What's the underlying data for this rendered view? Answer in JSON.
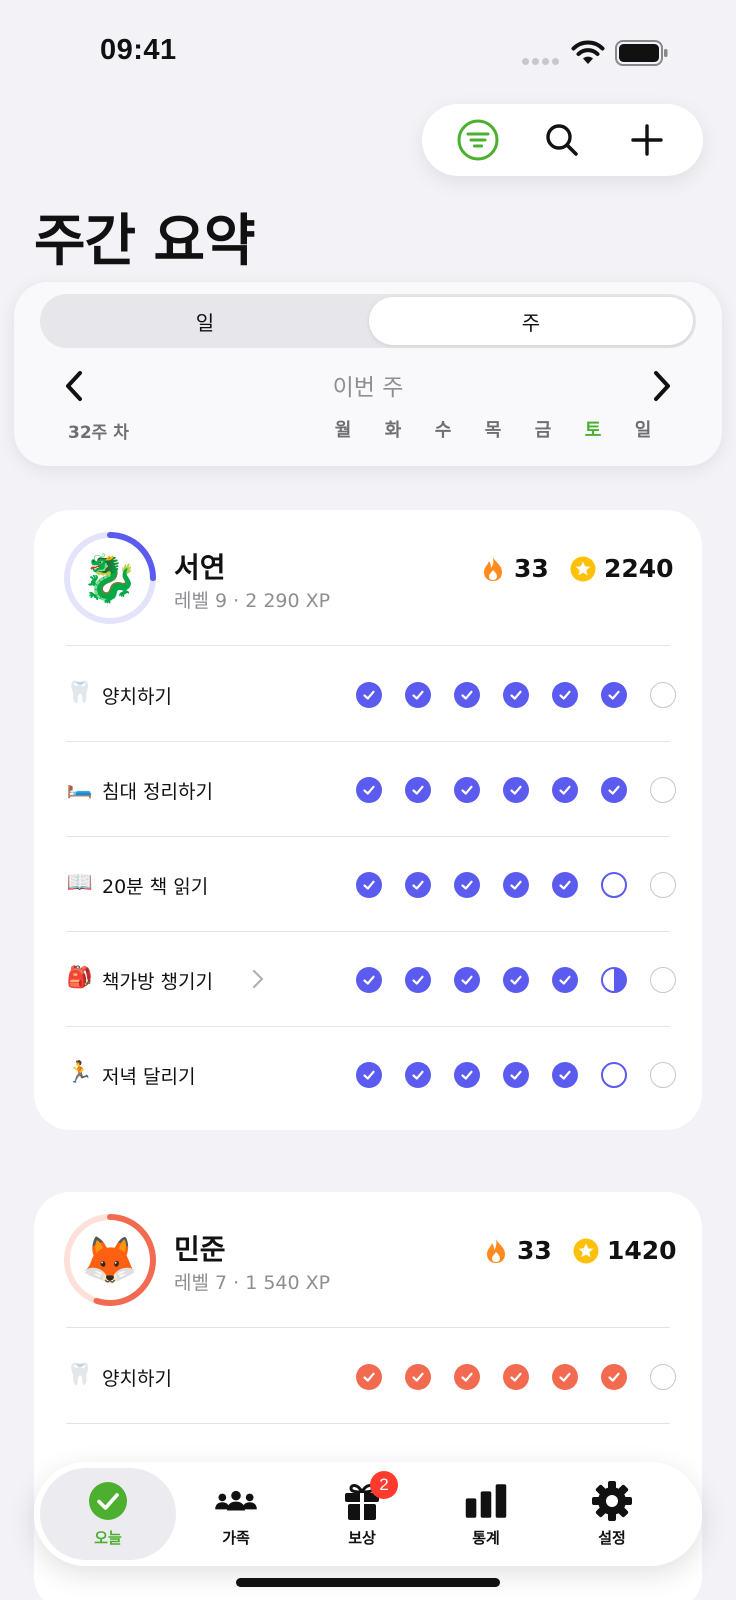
{
  "status_bar": {
    "time": "09:41"
  },
  "colors": {
    "accent_green": "#4caf2f",
    "member1": "#5b5bf0",
    "member2": "#f26b50",
    "flame": "#ff8a1e",
    "star": "#ffc107",
    "badge": "#ff3b30"
  },
  "top_actions": {
    "icons": [
      "filter-icon",
      "search-icon",
      "plus-icon"
    ]
  },
  "page": {
    "title": "주간 요약"
  },
  "week_panel": {
    "segments": [
      "일",
      "주"
    ],
    "selected_segment": "주",
    "week_label": "이번 주",
    "week_number": "32주 차",
    "weekdays": [
      "월",
      "화",
      "수",
      "목",
      "금",
      "토",
      "일"
    ],
    "today": "토"
  },
  "members": [
    {
      "name": "서연",
      "level": "레벨 9 · 2 290 XP",
      "avatar": "🐉",
      "level_progress": 0.25,
      "streak": "33",
      "stars": "2240",
      "tasks": [
        {
          "emoji": "🦷",
          "label": "양치하기",
          "status": [
            "done",
            "done",
            "done",
            "done",
            "done",
            "done",
            "empty"
          ]
        },
        {
          "emoji": "🛏️",
          "label": "침대 정리하기",
          "status": [
            "done",
            "done",
            "done",
            "done",
            "done",
            "done",
            "empty"
          ]
        },
        {
          "emoji": "📖",
          "label": "20분 책 읽기",
          "status": [
            "done",
            "done",
            "done",
            "done",
            "done",
            "ring",
            "empty"
          ]
        },
        {
          "emoji": "🎒",
          "label": "책가방 챙기기",
          "status": [
            "done",
            "done",
            "done",
            "done",
            "done",
            "half",
            "empty"
          ]
        },
        {
          "emoji": "🏃",
          "label": "저녁 달리기",
          "status": [
            "done",
            "done",
            "done",
            "done",
            "done",
            "ring",
            "empty"
          ]
        }
      ]
    },
    {
      "name": "민준",
      "level": "레벨 7 · 1 540 XP",
      "avatar": "🦊",
      "level_progress": 0.55,
      "streak": "33",
      "stars": "1420",
      "tasks": [
        {
          "emoji": "🦷",
          "label": "양치하기",
          "status": [
            "done",
            "done",
            "done",
            "done",
            "done",
            "done",
            "empty"
          ]
        }
      ]
    }
  ],
  "tab_bar": {
    "tabs": [
      {
        "label": "오늘",
        "icon": "checkmark-circle-icon"
      },
      {
        "label": "가족",
        "icon": "people-icon"
      },
      {
        "label": "보상",
        "icon": "gift-icon",
        "badge": "2"
      },
      {
        "label": "통계",
        "icon": "bar-chart-icon"
      },
      {
        "label": "설정",
        "icon": "gear-icon"
      }
    ]
  }
}
